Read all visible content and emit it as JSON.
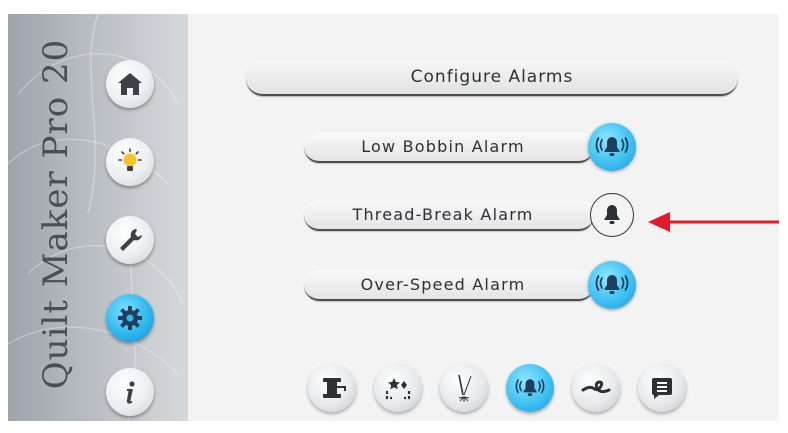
{
  "brand": {
    "title": "Quilt Maker Pro 20"
  },
  "sidebar": {
    "items": [
      {
        "name": "home",
        "icon": "home-icon",
        "active": false
      },
      {
        "name": "tips",
        "icon": "lightbulb-icon",
        "active": false
      },
      {
        "name": "tools",
        "icon": "wrench-icon",
        "active": false
      },
      {
        "name": "settings",
        "icon": "gear-icon",
        "active": true
      },
      {
        "name": "info",
        "icon": "info-icon",
        "active": false
      }
    ]
  },
  "header": {
    "title": "Configure Alarms"
  },
  "alarms": [
    {
      "label": "Low Bobbin Alarm",
      "state": "on"
    },
    {
      "label": "Thread-Break Alarm",
      "state": "off"
    },
    {
      "label": "Over-Speed Alarm",
      "state": "on"
    }
  ],
  "annotation": {
    "arrow_color": "#e11b2a",
    "target": "Thread-Break Alarm"
  },
  "tabs": [
    {
      "name": "bobbin",
      "icon": "bobbin-icon",
      "active": false
    },
    {
      "name": "stitch-regulation",
      "icon": "sparkle-corner-icon",
      "active": false
    },
    {
      "name": "needle",
      "icon": "needle-icon",
      "active": false
    },
    {
      "name": "alarms",
      "icon": "alarm-bell-icon",
      "active": true
    },
    {
      "name": "thread-knot",
      "icon": "knot-icon",
      "active": false
    },
    {
      "name": "messages",
      "icon": "message-icon",
      "active": false
    }
  ],
  "colors": {
    "accent": "#2fb7ef",
    "sidebar": "#b8bdc2",
    "text": "#2d3035"
  }
}
